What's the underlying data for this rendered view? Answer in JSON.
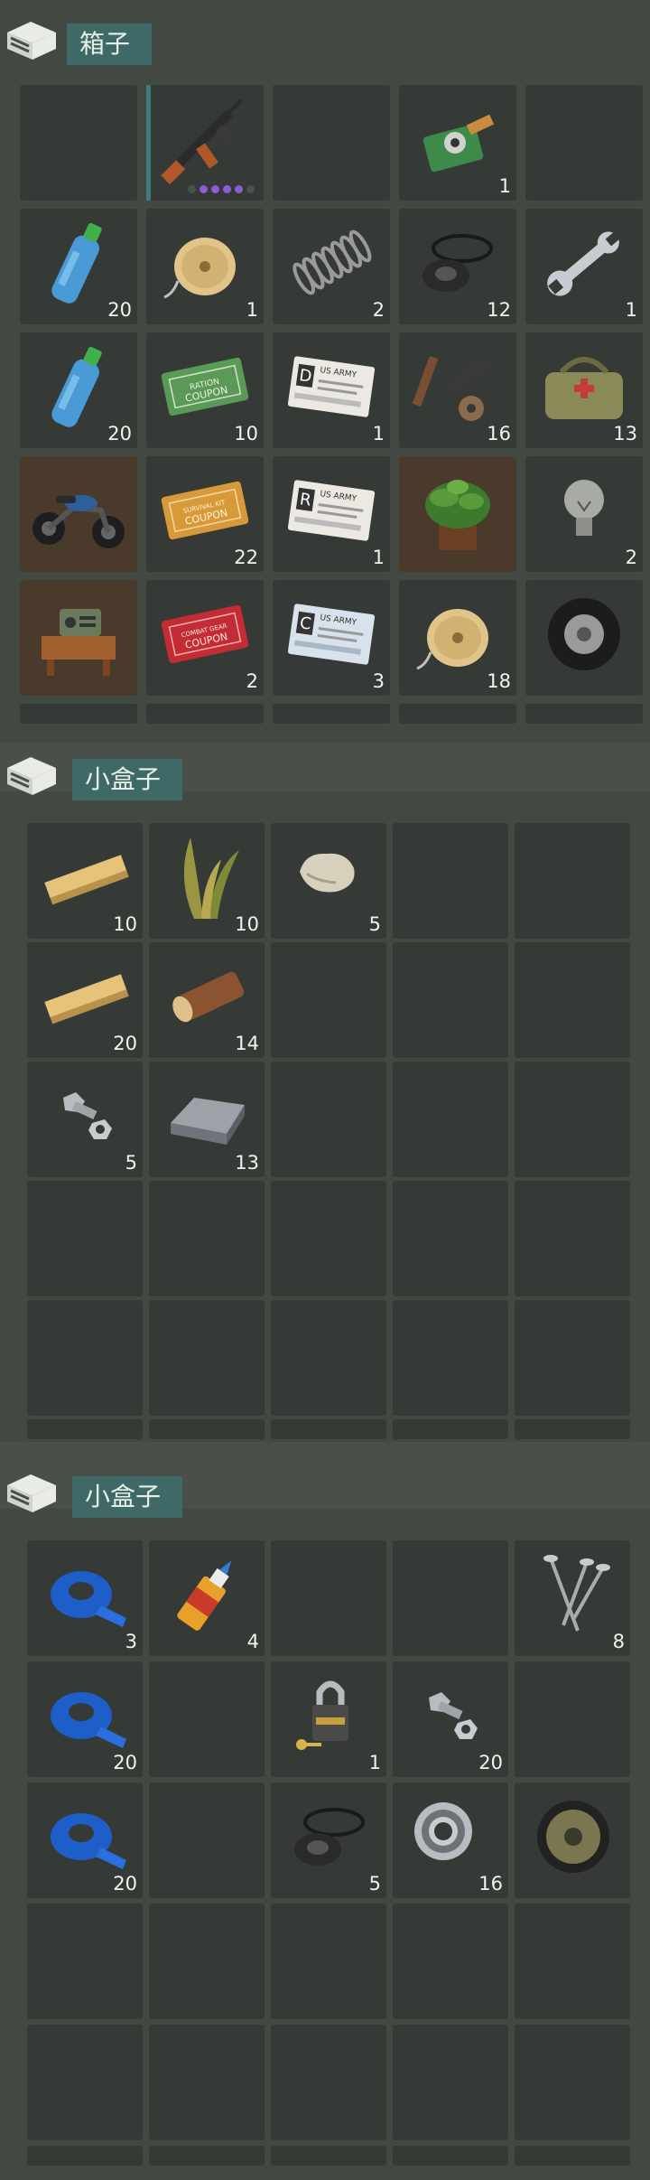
{
  "sections": [
    {
      "title": "箱子",
      "rows": [
        [
          {
            "icon": "assault-rifle-icon",
            "count": ""
          },
          {
            "icon": "empty",
            "count": ""
          },
          {
            "icon": "circuit-board-icon",
            "count": "1"
          },
          {
            "icon": "empty",
            "count": ""
          }
        ],
        [
          {
            "icon": "water-bottle-icon",
            "count": "20"
          },
          {
            "icon": "wire-spool-icon",
            "count": "1"
          },
          {
            "icon": "spring-icon",
            "count": "2"
          },
          {
            "icon": "rubber-seal-icon",
            "count": "12"
          },
          {
            "icon": "wrench-icon",
            "count": "1"
          }
        ],
        [
          {
            "icon": "water-bottle-icon",
            "count": "20"
          },
          {
            "icon": "ration-coupon-icon",
            "count": "10"
          },
          {
            "icon": "army-card-d-icon",
            "count": "1"
          },
          {
            "icon": "weapon-parts-icon",
            "count": "16"
          },
          {
            "icon": "first-aid-bag-icon",
            "count": "13"
          }
        ],
        [
          {
            "icon": "motorcycle-icon",
            "count": ""
          },
          {
            "icon": "survival-kit-coupon-icon",
            "count": "22"
          },
          {
            "icon": "army-card-r-icon",
            "count": "1"
          },
          {
            "icon": "potted-plant-icon",
            "count": ""
          },
          {
            "icon": "light-bulb-icon",
            "count": "2"
          }
        ],
        [
          {
            "icon": "radio-desk-icon",
            "count": ""
          },
          {
            "icon": "combat-gear-coupon-icon",
            "count": "2"
          },
          {
            "icon": "army-card-c-icon",
            "count": "3"
          },
          {
            "icon": "wire-spool-icon",
            "count": "18"
          },
          {
            "icon": "tire-icon",
            "count": ""
          }
        ]
      ]
    },
    {
      "title": "小盒子",
      "rows": [
        [
          {
            "icon": "wood-plank-icon",
            "count": "10"
          },
          {
            "icon": "plant-fiber-icon",
            "count": "10"
          },
          {
            "icon": "stone-icon",
            "count": "5"
          }
        ],
        [
          {
            "icon": "wood-plank-icon",
            "count": "20"
          },
          {
            "icon": "log-icon",
            "count": "14"
          }
        ],
        [
          {
            "icon": "bolt-nut-icon",
            "count": "5"
          },
          {
            "icon": "iron-ingot-icon",
            "count": "13"
          }
        ]
      ]
    },
    {
      "title": "小盒子",
      "rows": [
        [
          {
            "icon": "blue-tape-icon",
            "count": "3"
          },
          {
            "icon": "glue-icon",
            "count": "4"
          },
          {
            "icon": "empty",
            "count": ""
          },
          {
            "icon": "empty",
            "count": ""
          },
          {
            "icon": "nails-icon",
            "count": "8"
          }
        ],
        [
          {
            "icon": "blue-tape-icon",
            "count": "20"
          },
          {
            "icon": "empty",
            "count": ""
          },
          {
            "icon": "padlock-icon",
            "count": "1"
          },
          {
            "icon": "bolt-nut-icon",
            "count": "20"
          },
          {
            "icon": "empty",
            "count": ""
          }
        ],
        [
          {
            "icon": "blue-tape-icon",
            "count": "20"
          },
          {
            "icon": "empty",
            "count": ""
          },
          {
            "icon": "rubber-seal-icon",
            "count": "5"
          },
          {
            "icon": "bearing-icon",
            "count": "16"
          },
          {
            "icon": "wheel-icon",
            "count": ""
          }
        ]
      ]
    }
  ],
  "colors": {
    "accent": "#3f6966",
    "slot": "#353a36",
    "background": "#4a4f4a"
  }
}
